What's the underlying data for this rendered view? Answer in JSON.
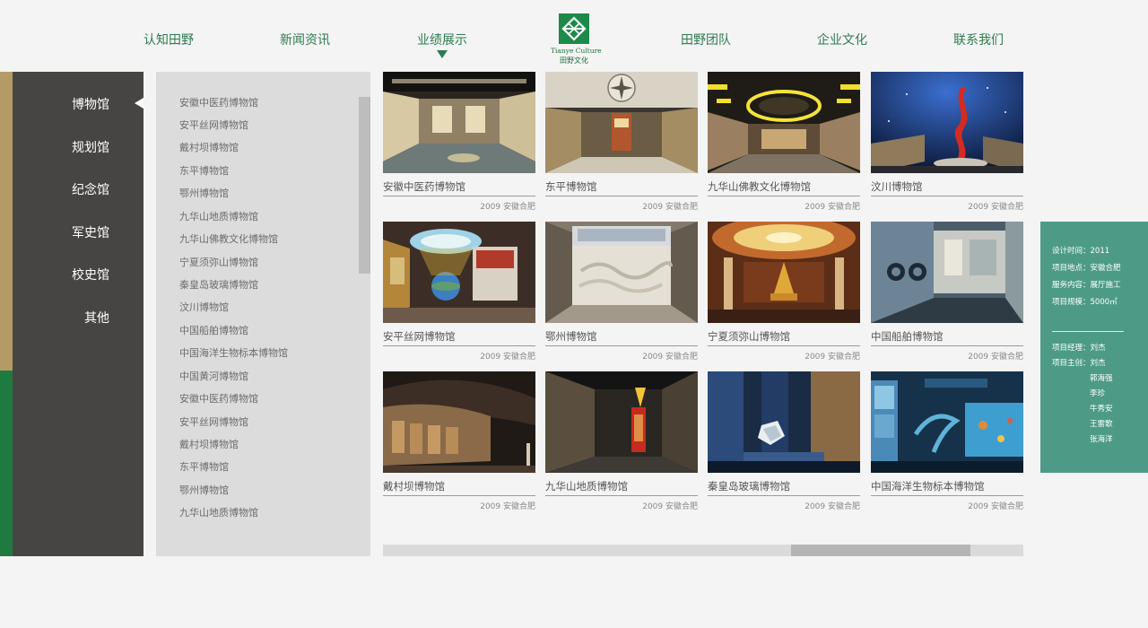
{
  "nav": {
    "items": [
      "认知田野",
      "新闻资讯",
      "业绩展示",
      "田野团队",
      "企业文化",
      "联系我们"
    ],
    "logo_en": "Tianye Culture",
    "logo_cn": "田野文化"
  },
  "categories": [
    "博物馆",
    "规划馆",
    "纪念馆",
    "军史馆",
    "校史馆",
    "其他"
  ],
  "museum_list": [
    "安徽中医药博物馆",
    "安平丝网博物馆",
    "戴村坝博物馆",
    "东平博物馆",
    "鄂州博物馆",
    "九华山地质博物馆",
    "九华山佛教文化博物馆",
    "宁夏须弥山博物馆",
    "秦皇岛玻璃博物馆",
    "汶川博物馆",
    "中国船舶博物馆",
    "中国海洋生物标本博物馆",
    "中国黄河博物馆",
    "安徽中医药博物馆",
    "安平丝网博物馆",
    "戴村坝博物馆",
    "东平博物馆",
    "鄂州博物馆",
    "九华山地质博物馆"
  ],
  "projects": [
    {
      "title": "安徽中医药博物馆",
      "meta": "2009  安徽合肥"
    },
    {
      "title": "东平博物馆",
      "meta": "2009  安徽合肥"
    },
    {
      "title": "九华山佛教文化博物馆",
      "meta": "2009  安徽合肥"
    },
    {
      "title": "汶川博物馆",
      "meta": "2009  安徽合肥"
    },
    {
      "title": "安平丝网博物馆",
      "meta": "2009  安徽合肥"
    },
    {
      "title": "鄂州博物馆",
      "meta": "2009  安徽合肥"
    },
    {
      "title": "宁夏须弥山博物馆",
      "meta": "2009  安徽合肥"
    },
    {
      "title": "中国船舶博物馆",
      "meta": "2009  安徽合肥"
    },
    {
      "title": "戴村坝博物馆",
      "meta": "2009  安徽合肥"
    },
    {
      "title": "九华山地质博物馆",
      "meta": "2009  安徽合肥"
    },
    {
      "title": "秦皇岛玻璃博物馆",
      "meta": "2009  安徽合肥"
    },
    {
      "title": "中国海洋生物标本博物馆",
      "meta": "2009  安徽合肥"
    }
  ],
  "detail": {
    "lines": [
      "设计时间：2011",
      "项目地点：安徽合肥",
      "服务内容：展厅施工",
      "项目规模：5000㎡"
    ],
    "manager": "项目经理：刘杰",
    "lead": "项目主创：刘杰",
    "members": [
      "郭海强",
      "李珍",
      "牛秀安",
      "王雷歌",
      "张海洋"
    ]
  },
  "colors": {
    "accent_green": "#2f7a52",
    "sidebar_dark": "#474543",
    "detail_teal": "#4d9b87",
    "gold_stripe": "#b49b66"
  }
}
